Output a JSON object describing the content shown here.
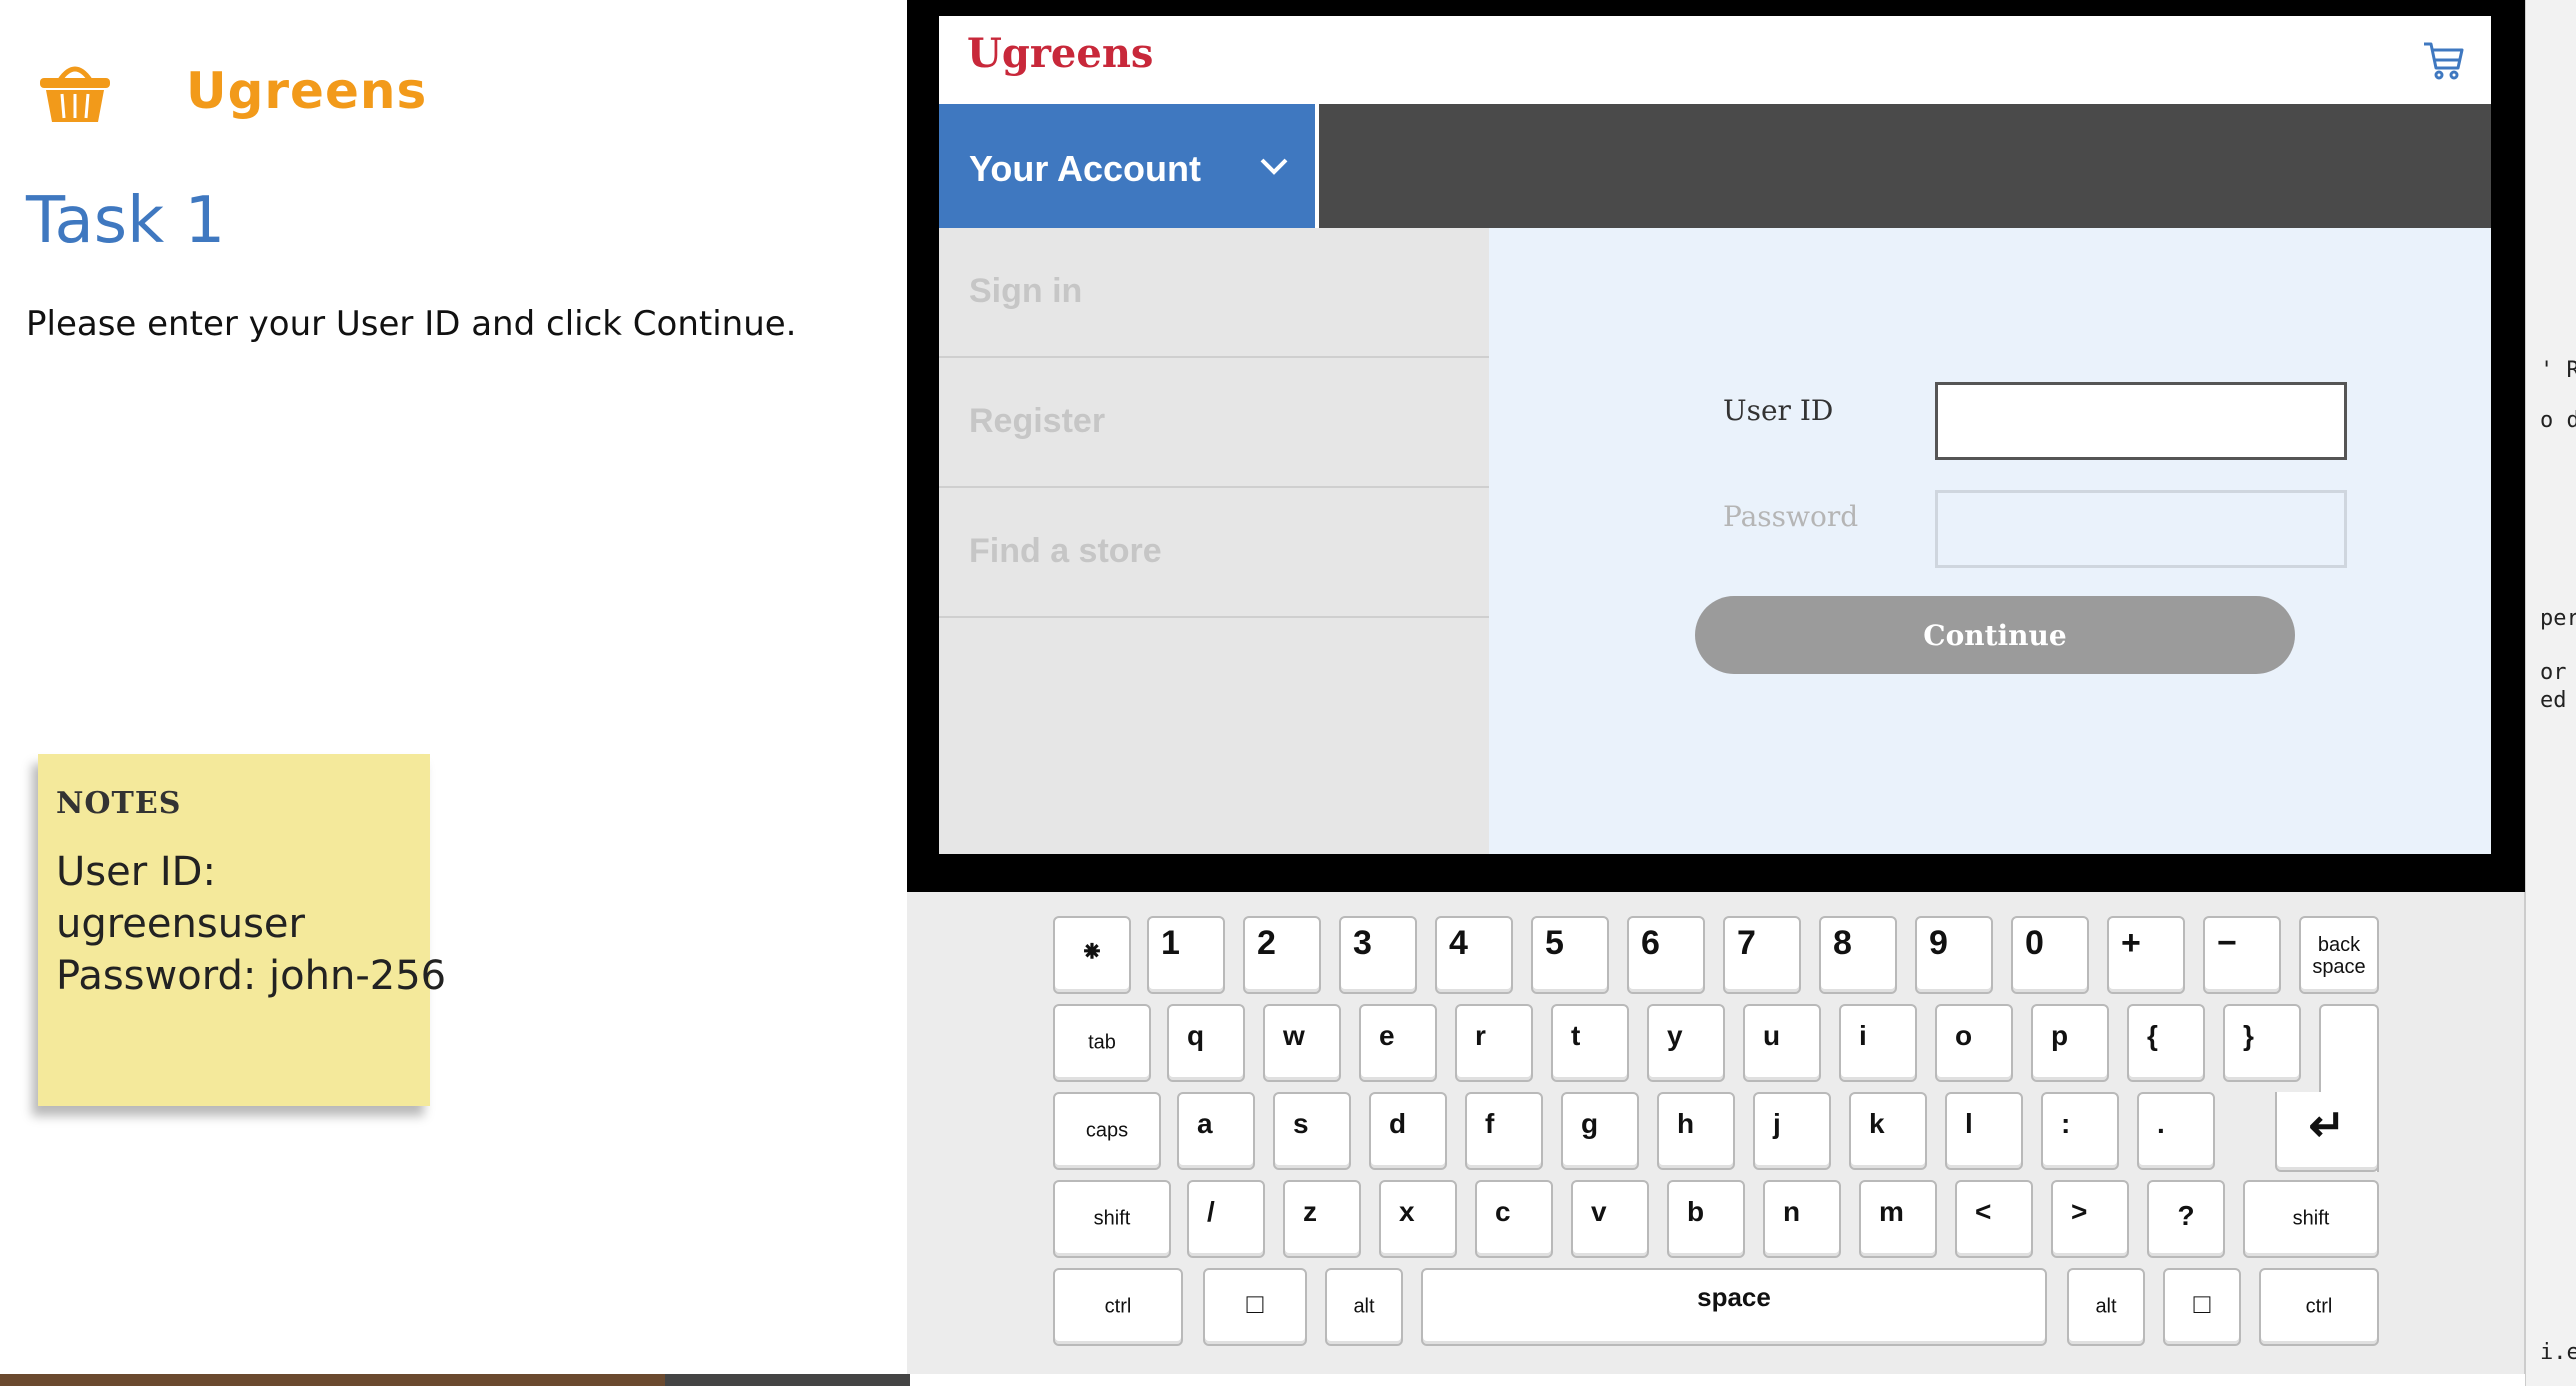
{
  "task_panel": {
    "brand_name": "Ugreens",
    "task_title": "Task 1",
    "instruction": "Please enter your User ID and click Continue.",
    "note": {
      "title": "NOTES",
      "body": "User ID:\nugreensuser\nPassword: john-256"
    }
  },
  "app": {
    "logo": "Ugreens",
    "account_menu_label": "Your Account",
    "menu_items": [
      "Sign in",
      "Register",
      "Find a store"
    ],
    "form": {
      "user_id_label": "User ID",
      "user_id_value": "",
      "password_label": "Password",
      "password_value": "",
      "continue_label": "Continue"
    },
    "colors": {
      "brand_orange": "#f29a1a",
      "brand_red": "#c8283a",
      "accent_blue": "#3f78c0",
      "nav_dark": "#4a4a4a",
      "panel_light_blue": "#eaf2fb"
    }
  },
  "keyboard": {
    "row1": [
      "⁕",
      "1",
      "2",
      "3",
      "4",
      "5",
      "6",
      "7",
      "8",
      "9",
      "0",
      "+",
      "−",
      "back space"
    ],
    "row2": [
      "tab",
      "q",
      "w",
      "e",
      "r",
      "t",
      "y",
      "u",
      "i",
      "o",
      "p",
      "{",
      "}"
    ],
    "row3": [
      "caps",
      "a",
      "s",
      "d",
      "f",
      "g",
      "h",
      "j",
      "k",
      "l",
      ":",
      ".",
      "↵"
    ],
    "row4": [
      "shift",
      "/",
      "z",
      "x",
      "c",
      "v",
      "b",
      "n",
      "m",
      "<",
      ">",
      "?",
      "shift"
    ],
    "row5": [
      "ctrl",
      "□",
      "alt",
      "space",
      "alt",
      "□",
      "ctrl"
    ]
  },
  "right_edge_fragments": [
    "' Re",
    "o d",
    "per",
    "or",
    "ed",
    "i.ec"
  ]
}
